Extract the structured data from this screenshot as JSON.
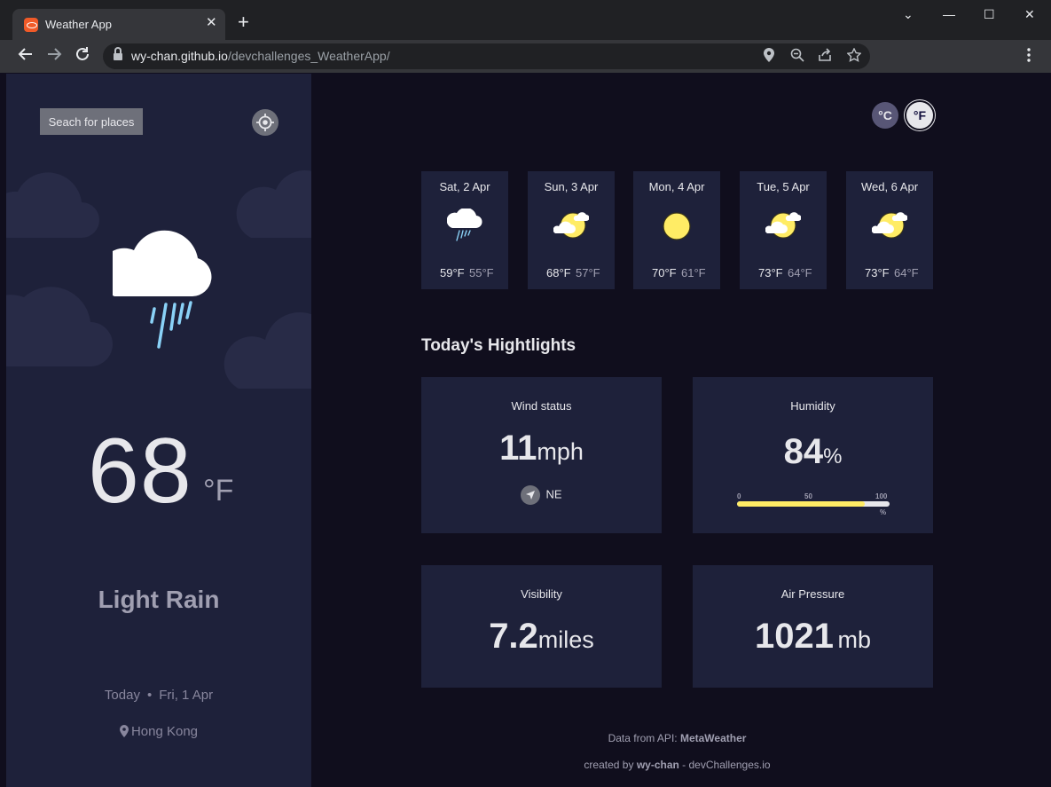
{
  "browser": {
    "tab_title": "Weather App",
    "tab_close": "✕",
    "new_tab": "+",
    "url_host": "wy-chan.github.io",
    "url_path": "/devchallenges_WeatherApp/",
    "win_min": "—",
    "win_max": "☐",
    "win_close": "✕",
    "win_dropdown": "⌄"
  },
  "sidebar": {
    "search_label": "Seach for places",
    "temperature": "68",
    "temperature_unit": "°F",
    "condition": "Light Rain",
    "date_prefix": "Today",
    "date_sep": "•",
    "date": "Fri, 1 Apr",
    "location": "Hong Kong"
  },
  "units": {
    "celsius": "°C",
    "fahrenheit": "°F",
    "selected": "fahrenheit"
  },
  "forecast": [
    {
      "day": "Sat, 2 Apr",
      "icon": "light-rain",
      "max": "59°F",
      "min": "55°F"
    },
    {
      "day": "Sun, 3 Apr",
      "icon": "light-cloud",
      "max": "68°F",
      "min": "57°F"
    },
    {
      "day": "Mon, 4 Apr",
      "icon": "clear",
      "max": "70°F",
      "min": "61°F"
    },
    {
      "day": "Tue, 5 Apr",
      "icon": "light-cloud",
      "max": "73°F",
      "min": "64°F"
    },
    {
      "day": "Wed, 6 Apr",
      "icon": "light-cloud",
      "max": "73°F",
      "min": "64°F"
    }
  ],
  "highlights": {
    "title": "Today's Hightlights",
    "wind": {
      "label": "Wind status",
      "value": "11",
      "unit": "mph",
      "direction": "NE"
    },
    "humidity": {
      "label": "Humidity",
      "value": "84",
      "unit": "%",
      "scale_0": "0",
      "scale_50": "50",
      "scale_100": "100",
      "scale_unit": "%",
      "fraction": 0.84
    },
    "visibility": {
      "label": "Visibility",
      "value": "7.2",
      "unit": "miles"
    },
    "pressure": {
      "label": "Air Pressure",
      "value": "1021",
      "unit": "mb"
    }
  },
  "footer": {
    "api_prefix": "Data from API:",
    "api_name": "MetaWeather",
    "credit_prefix": "created by",
    "credit_name": "wy-chan",
    "credit_suffix": "- devChallenges.io"
  },
  "colors": {
    "sidebar_bg": "#1e213a",
    "main_bg": "#100e1d",
    "card_bg": "#1e213a",
    "humidity_bar": "#ffec65",
    "text_primary": "#e7e7eb",
    "text_muted": "#a09fb1"
  }
}
